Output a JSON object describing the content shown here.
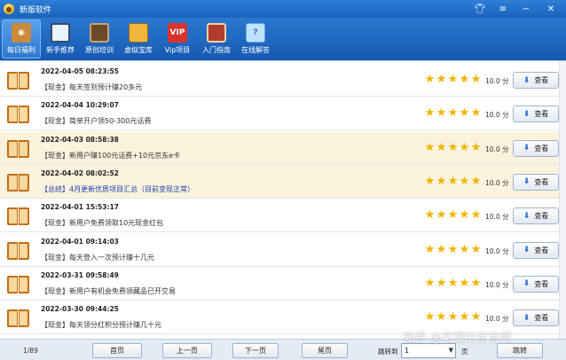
{
  "window": {
    "title": "新版软件"
  },
  "toolbar": [
    {
      "label": "每日福利",
      "icon": "owl-icon",
      "active": true
    },
    {
      "label": "新手推荐",
      "icon": "monitor-icon"
    },
    {
      "label": "原创培训",
      "icon": "blackboard-icon"
    },
    {
      "label": "虚拟宝库",
      "icon": "treasure-box-icon",
      "badge": ""
    },
    {
      "label": "Vip项目",
      "icon": "vip-icon",
      "badge": "VIP"
    },
    {
      "label": "入门指南",
      "icon": "door-icon"
    },
    {
      "label": "在线解答",
      "icon": "chat-bubble-icon",
      "badge": "?"
    }
  ],
  "items": [
    {
      "date": "2022-04-05 08:23:55",
      "text": "【现金】每天签到预计赚20多元",
      "score": "10.0 分",
      "highlight": false,
      "blue": false
    },
    {
      "date": "2022-04-04 10:29:07",
      "text": "【现金】简单开户领50-300元话费",
      "score": "10.0 分",
      "highlight": false,
      "blue": false
    },
    {
      "date": "2022-04-03 08:58:38",
      "text": "【现金】新用户赚100元话费+10元京东e卡",
      "score": "10.0 分",
      "highlight": true,
      "blue": false
    },
    {
      "date": "2022-04-02 08:02:52",
      "text": "【总结】4月更新优质项目汇总（目前变现正常）",
      "score": "10.0 分",
      "highlight": true,
      "blue": true
    },
    {
      "date": "2022-04-01 15:53:17",
      "text": "【现金】新用户免费领取10元现金红包",
      "score": "10.0 分",
      "highlight": false,
      "blue": false
    },
    {
      "date": "2022-04-01 09:14:03",
      "text": "【现金】每天登入一次预计赚十几元",
      "score": "10.0 分",
      "highlight": false,
      "blue": false
    },
    {
      "date": "2022-03-31 09:58:49",
      "text": "【现金】新用户有机会免费领藏品已开交易",
      "score": "10.0 分",
      "highlight": false,
      "blue": false
    },
    {
      "date": "2022-03-30 09:44:25",
      "text": "【现金】每天领分红积分预计赚几十元",
      "score": "10.0 分",
      "highlight": false,
      "blue": false
    }
  ],
  "view_label": "查看",
  "footer": {
    "page_info": "1/89",
    "first": "首页",
    "prev": "上一页",
    "next": "下一页",
    "last": "尾页",
    "jump_label": "跳转到",
    "jump_value": "1",
    "page_unit": "页",
    "jump_button": "跳转"
  },
  "watermark": "知乎 @可爱的宝宝啊",
  "colors": {
    "titlebar": "#1a63bd",
    "star": "#f3b400",
    "highlight_row": "#fbf3dd",
    "blue_text": "#1d3fb0"
  }
}
